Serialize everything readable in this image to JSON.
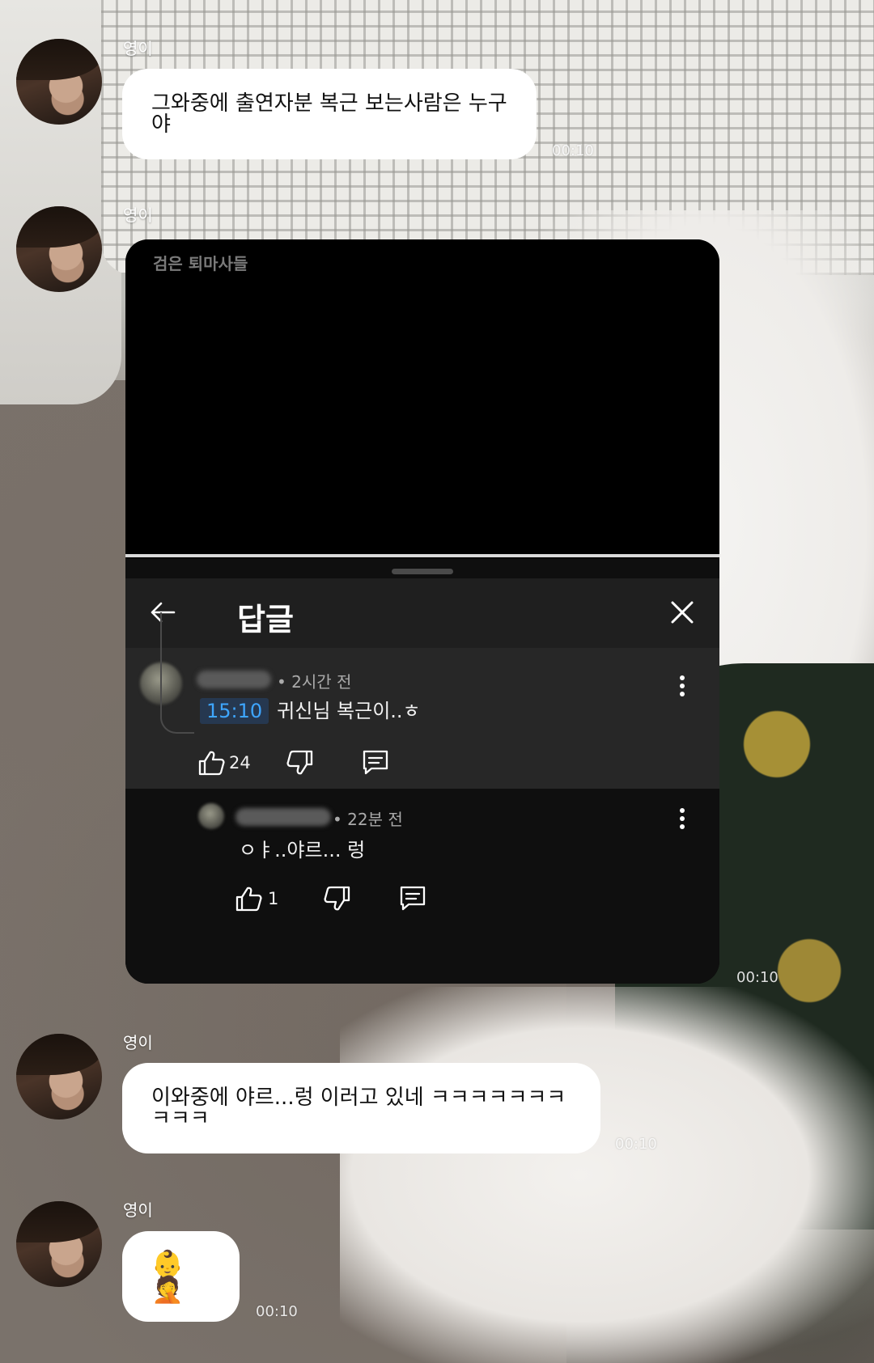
{
  "messages": [
    {
      "sender": "영이",
      "text": "그와중에 출연자분 복근 보는사람은 누구야",
      "time": "00:10"
    },
    {
      "sender": "영이",
      "time": "00:10"
    },
    {
      "sender": "영이",
      "text": "이와중에 야르...렁 이러고 있네 ㅋㅋㅋㅋㅋㅋㅋㅋㅋㅋ",
      "time": "00:10"
    },
    {
      "sender": "영이",
      "text": "👶🤦",
      "time": "00:10"
    }
  ],
  "youtube_screenshot": {
    "video_title_overlay": "검은 퇴마사들",
    "progress_fraction": 1.0,
    "sheet_title": "답글",
    "parent_comment": {
      "meta": "• 2시간 전",
      "timestamp": "15:10",
      "text": "귀신님 복근이..ㅎ",
      "likes": "24"
    },
    "reply_comment": {
      "meta": "• 22분 전",
      "text": "ㅇㅑ..야르... 렁",
      "likes": "1"
    }
  },
  "colors": {
    "bubble": "#ffffff",
    "timestamp_link": "#3ea6ff",
    "sheet_bg": "#0f0f0f",
    "parent_bg": "#272727"
  },
  "icons": [
    "back-arrow-icon",
    "close-icon",
    "more-vert-icon",
    "thumb-up-icon",
    "thumb-down-icon",
    "reply-icon"
  ]
}
